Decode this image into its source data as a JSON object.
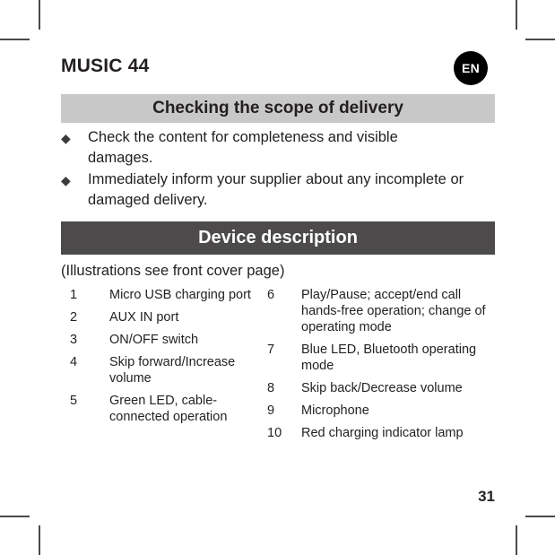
{
  "document": {
    "title": "MUSIC 44",
    "language_badge": "EN",
    "page_number": "31"
  },
  "sections": {
    "scope": {
      "heading": "Checking the scope of delivery",
      "bullet_glyph": "◆",
      "bullets": [
        "Check the content for completeness and visible damages.",
        "Immediately inform your supplier about any incomplete or damaged delivery."
      ]
    },
    "device": {
      "heading": "Device description",
      "note": "(Illustrations see front cover page)",
      "left_column": [
        {
          "num": "1",
          "text": "Micro USB charging port"
        },
        {
          "num": "2",
          "text": "AUX IN port"
        },
        {
          "num": "3",
          "text": "ON/OFF switch"
        },
        {
          "num": "4",
          "text": "Skip forward/Increase volume"
        },
        {
          "num": "5",
          "text": "Green LED, cable-connected operation"
        }
      ],
      "right_column": [
        {
          "num": "6",
          "text": "Play/Pause; accept/end call hands-free operation; change of operating mode"
        },
        {
          "num": "7",
          "text": "Blue LED, Bluetooth operating mode"
        },
        {
          "num": "8",
          "text": "Skip back/Decrease volume"
        },
        {
          "num": "9",
          "text": "Microphone"
        },
        {
          "num": "10",
          "text": "Red charging indicator lamp"
        }
      ]
    }
  },
  "colors": {
    "bar_light": "#c8c8c8",
    "bar_dark": "#4c4a4a",
    "text": "#231f20",
    "badge_background": "#000000"
  }
}
